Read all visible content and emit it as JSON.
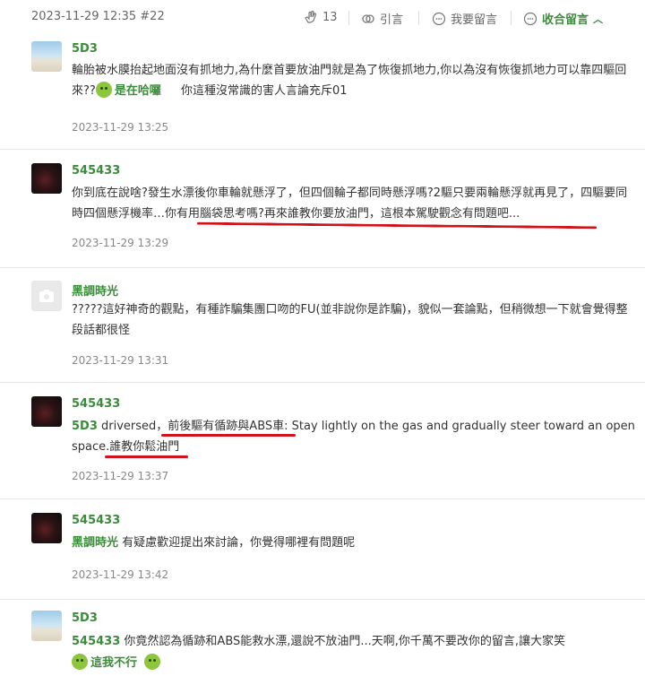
{
  "post": {
    "meta": "2023-11-29 12:35 #22",
    "like_count": "13",
    "quote_label": "引言",
    "reply_label": "我要留言",
    "collapse_label": "收合留言"
  },
  "comments": [
    {
      "author": "5D3",
      "text": "輪胎被水膜抬起地面沒有抓地力,為什麼首要放油門就是為了恢復抓地力,你以為沒有恢復抓地力可以靠四驅回來??",
      "sticker_text": "是在哈囉",
      "tail": "你這種沒常識的害人言論充斥01",
      "time": "2023-11-29 13:25"
    },
    {
      "author": "545433",
      "text": "你到底在說啥?發生水漂後你車輪就懸浮了，但四個輪子都同時懸浮嗎?2驅只要兩輪懸浮就再見了，四驅要同時四個懸浮機率…你有用腦袋思考嗎?再來誰教你要放油門，這根本駕駛觀念有問題吧...",
      "time": "2023-11-29 13:29"
    },
    {
      "author": "黑調時光",
      "text": "?????這好神奇的觀點，有種詐騙集團口吻的FU(並非說你是詐騙)，貌似一套論點，但稍微想一下就會覺得整段話都很怪",
      "time": "2023-11-29 13:31"
    },
    {
      "author": "545433",
      "mention": "5D3",
      "text": "driversed，前後驅有循跡與ABS車: Stay lightly on the gas and gradually steer toward an open space.誰教你鬆油門",
      "time": "2023-11-29 13:37"
    },
    {
      "author": "545433",
      "mention": "黑調時光",
      "text": "有疑慮歡迎提出來討論，你覺得哪裡有問題呢",
      "time": "2023-11-29 13:42"
    },
    {
      "author": "5D3",
      "mention": "545433",
      "text": "你竟然認為循跡和ABS能救水漂,還說不放油門...天啊,你千萬不要改你的留言,讓大家笑",
      "sticker_text": "這我不行"
    }
  ],
  "colors": {
    "accent": "#3a8c3a",
    "highlight_underline": "#d0141c"
  }
}
